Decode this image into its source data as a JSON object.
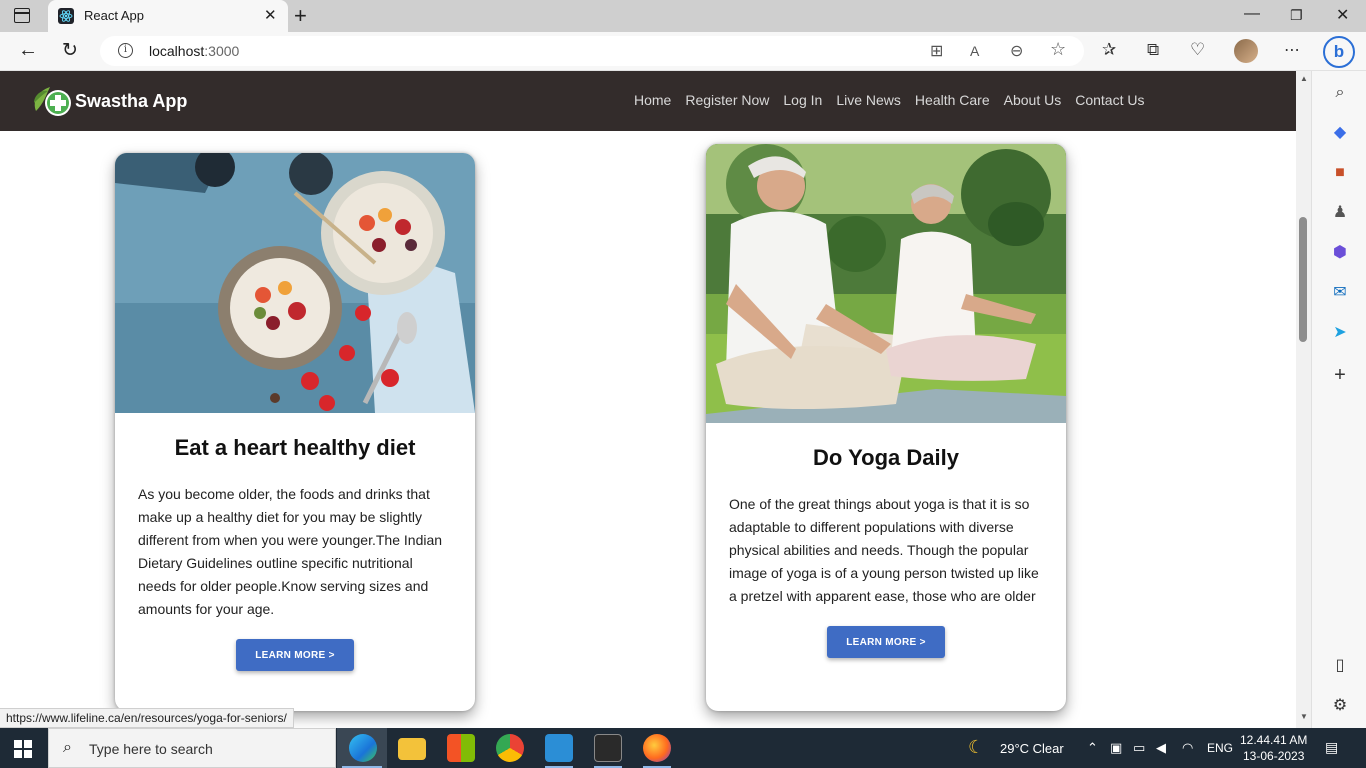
{
  "browser": {
    "tab_title": "React App",
    "url_host": "localhost",
    "url_port": ":3000",
    "status_link": "https://www.lifeline.ca/en/resources/yoga-for-seniors/"
  },
  "app": {
    "brand": "Swastha App",
    "nav": [
      "Home",
      "Register Now",
      "Log In",
      "Live News",
      "Health Care",
      "About Us",
      "Contact Us"
    ]
  },
  "cards": [
    {
      "title": "Eat a heart healthy diet",
      "text": "As you become older, the foods and drinks that make up a healthy diet for you may be slightly different from when you were younger.The Indian Dietary Guidelines outline specific nutritional needs for older people.Know serving sizes and amounts for your age.",
      "button": "LEARN MORE >"
    },
    {
      "title": "Do Yoga Daily",
      "text": "One of the great things about yoga is that it is so adaptable to different populations with diverse physical abilities and needs. Though the popular image of yoga is of a young person twisted up like a pretzel with apparent ease, those who are older",
      "button": "LEARN MORE >"
    }
  ],
  "taskbar": {
    "search_placeholder": "Type here to search",
    "weather": "29°C  Clear",
    "lang": "ENG",
    "time": "12.44.41 AM",
    "date": "13-06-2023"
  },
  "colors": {
    "nav_bg": "#332c2b",
    "button_bg": "#3f6cc4",
    "taskbar_bg": "#1e2a36"
  }
}
